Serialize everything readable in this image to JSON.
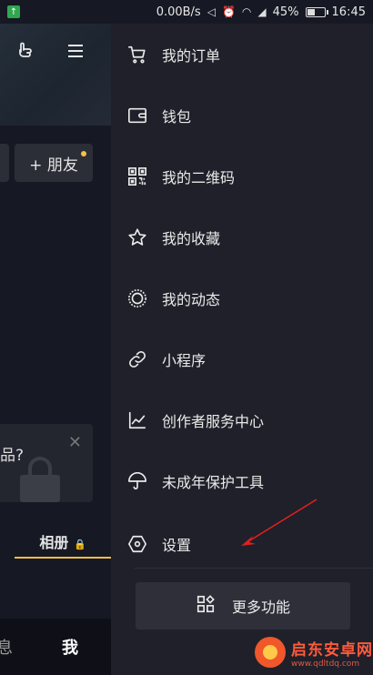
{
  "status_bar": {
    "network_speed": "0.00B/s",
    "battery": "45%",
    "time": "16:45"
  },
  "background_page": {
    "add_friend_label": "+ 朋友",
    "prompt_fragment": "品?",
    "album_tab": "相册",
    "tab_messages": "息",
    "tab_me": "我"
  },
  "drawer": {
    "menu": [
      {
        "label": "我的订单",
        "icon": "cart-icon"
      },
      {
        "label": "钱包",
        "icon": "wallet-icon"
      },
      {
        "label": "我的二维码",
        "icon": "qr-code-icon"
      },
      {
        "label": "我的收藏",
        "icon": "star-icon"
      },
      {
        "label": "我的动态",
        "icon": "activity-ring-icon"
      },
      {
        "label": "小程序",
        "icon": "link-icon"
      },
      {
        "label": "创作者服务中心",
        "icon": "chart-line-icon"
      },
      {
        "label": "未成年保护工具",
        "icon": "umbrella-icon"
      },
      {
        "label": "设置",
        "icon": "settings-hexagon-icon"
      }
    ],
    "more_button": "更多功能"
  },
  "watermark": {
    "name": "启东安卓网",
    "url": "www.qdltdq.com"
  },
  "colors": {
    "drawer_bg": "#1f2029",
    "page_bg": "#161823",
    "accent_yellow": "#f6c142",
    "annotation_red": "#e02020"
  }
}
